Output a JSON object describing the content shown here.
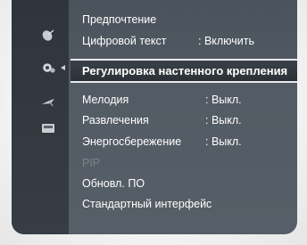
{
  "menu": {
    "items": [
      {
        "label": "Предпочтение",
        "value": ""
      },
      {
        "label": "Цифровой текст",
        "value": ": Включить"
      },
      {
        "label": "Регулировка настенного крепления",
        "value": "",
        "selected": true
      },
      {
        "label": "Мелодия",
        "value": ": Выкл."
      },
      {
        "label": "Развлечения",
        "value": ": Выкл."
      },
      {
        "label": "Энергосбережение",
        "value": ": Выкл."
      },
      {
        "label": "PIP",
        "value": "",
        "disabled": true
      },
      {
        "label": "Обновл. ПО",
        "value": ""
      },
      {
        "label": "Стандартный интерфейс",
        "value": ""
      }
    ]
  },
  "sidebar": {
    "icons": [
      "satellite-dish-icon",
      "gear-settings-icon",
      "input-plug-icon",
      "application-icon"
    ],
    "active_index": 1
  },
  "colors": {
    "panel": "#545c65",
    "sidebar": "#333a41",
    "text": "#ffffff",
    "disabled_text": "#7d848b",
    "highlight_border": "#e7eaec"
  }
}
